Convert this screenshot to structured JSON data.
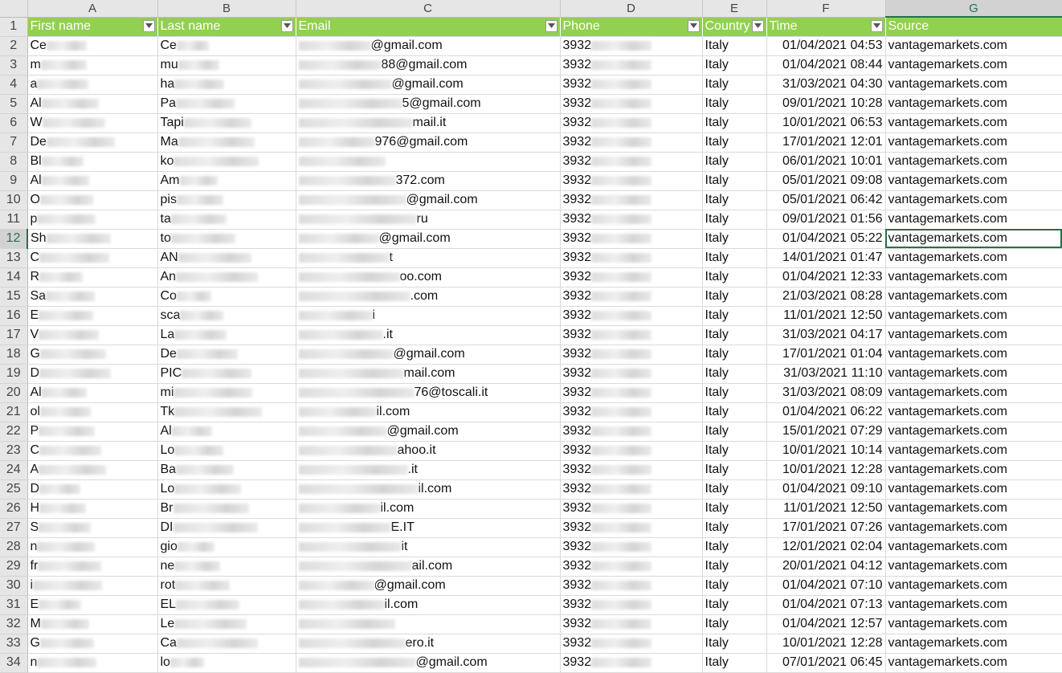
{
  "columns": [
    "A",
    "B",
    "C",
    "D",
    "E",
    "F",
    "G"
  ],
  "headers": [
    "First name",
    "Last name",
    "Email",
    "Phone",
    "Country",
    "Time",
    "Source"
  ],
  "rows": [
    {
      "num": "2",
      "first": "Ce",
      "last": "Ce",
      "email": "@gmail.com",
      "phone": "3932",
      "country": "Italy",
      "time": "01/04/2021 04:53",
      "source": "vantagemarkets.com"
    },
    {
      "num": "3",
      "first": "m",
      "last": "mu",
      "email": "88@gmail.com",
      "phone": "3932",
      "country": "Italy",
      "time": "01/04/2021 08:44",
      "source": "vantagemarkets.com"
    },
    {
      "num": "4",
      "first": "a",
      "last": "ha",
      "email": "@gmail.com",
      "phone": "3932",
      "country": "Italy",
      "time": "31/03/2021 04:30",
      "source": "vantagemarkets.com"
    },
    {
      "num": "5",
      "first": "Al",
      "last": "Pa",
      "email": "5@gmail.com",
      "phone": "3932",
      "country": "Italy",
      "time": "09/01/2021 10:28",
      "source": "vantagemarkets.com"
    },
    {
      "num": "6",
      "first": "W",
      "last": "Tapi",
      "email": "mail.it",
      "phone": "3932",
      "country": "Italy",
      "time": "10/01/2021 06:53",
      "source": "vantagemarkets.com"
    },
    {
      "num": "7",
      "first": "De",
      "last": "Ma",
      "email": "976@gmail.com",
      "phone": "3932",
      "country": "Italy",
      "time": "17/01/2021 12:01",
      "source": "vantagemarkets.com"
    },
    {
      "num": "8",
      "first": "Bl",
      "last": "ko",
      "email": "",
      "phone": "3932",
      "country": "Italy",
      "time": "06/01/2021 10:01",
      "source": "vantagemarkets.com"
    },
    {
      "num": "9",
      "first": "Al",
      "last": "Am",
      "email": "372.com",
      "phone": "3932",
      "country": "Italy",
      "time": "05/01/2021 09:08",
      "source": "vantagemarkets.com"
    },
    {
      "num": "10",
      "first": "O",
      "last": "pis",
      "email": "@gmail.com",
      "phone": "3932",
      "country": "Italy",
      "time": "05/01/2021 06:42",
      "source": "vantagemarkets.com"
    },
    {
      "num": "11",
      "first": "p",
      "last": "ta",
      "email": "ru",
      "phone": "3932",
      "country": "Italy",
      "time": "09/01/2021 01:56",
      "source": "vantagemarkets.com"
    },
    {
      "num": "12",
      "first": "Sh",
      "last": "to",
      "email": "@gmail.com",
      "phone": "3932",
      "country": "Italy",
      "time": "01/04/2021 05:22",
      "source": "vantagemarkets.com"
    },
    {
      "num": "13",
      "first": "C",
      "last": "AN",
      "email": "t",
      "phone": "3932",
      "country": "Italy",
      "time": "14/01/2021 01:47",
      "source": "vantagemarkets.com"
    },
    {
      "num": "14",
      "first": "R",
      "last": "An",
      "email": "oo.com",
      "phone": "3932",
      "country": "Italy",
      "time": "01/04/2021 12:33",
      "source": "vantagemarkets.com"
    },
    {
      "num": "15",
      "first": "Sa",
      "last": "Co",
      "email": ".com",
      "phone": "3932",
      "country": "Italy",
      "time": "21/03/2021 08:28",
      "source": "vantagemarkets.com"
    },
    {
      "num": "16",
      "first": "E",
      "last": "sca",
      "email": "i",
      "phone": "3932",
      "country": "Italy",
      "time": "11/01/2021 12:50",
      "source": "vantagemarkets.com"
    },
    {
      "num": "17",
      "first": "V",
      "last": "La",
      "email": ".it",
      "phone": "3932",
      "country": "Italy",
      "time": "31/03/2021 04:17",
      "source": "vantagemarkets.com"
    },
    {
      "num": "18",
      "first": "G",
      "last": "De",
      "email": "@gmail.com",
      "phone": "3932",
      "country": "Italy",
      "time": "17/01/2021 01:04",
      "source": "vantagemarkets.com"
    },
    {
      "num": "19",
      "first": "D",
      "last": "PIC",
      "email": "mail.com",
      "phone": "3932",
      "country": "Italy",
      "time": "31/03/2021 11:10",
      "source": "vantagemarkets.com"
    },
    {
      "num": "20",
      "first": "Al",
      "last": "mi",
      "email": "76@toscali.it",
      "phone": "3932",
      "country": "Italy",
      "time": "31/03/2021 08:09",
      "source": "vantagemarkets.com"
    },
    {
      "num": "21",
      "first": "ol",
      "last": "Tk",
      "email": "il.com",
      "phone": "3932",
      "country": "Italy",
      "time": "01/04/2021 06:22",
      "source": "vantagemarkets.com"
    },
    {
      "num": "22",
      "first": "P",
      "last": "Al",
      "email": "@gmail.com",
      "phone": "3932",
      "country": "Italy",
      "time": "15/01/2021 07:29",
      "source": "vantagemarkets.com"
    },
    {
      "num": "23",
      "first": "C",
      "last": "Lo",
      "email": "ahoo.it",
      "phone": "3932",
      "country": "Italy",
      "time": "10/01/2021 10:14",
      "source": "vantagemarkets.com"
    },
    {
      "num": "24",
      "first": "A",
      "last": "Ba",
      "email": ".it",
      "phone": "3932",
      "country": "Italy",
      "time": "10/01/2021 12:28",
      "source": "vantagemarkets.com"
    },
    {
      "num": "25",
      "first": "D",
      "last": "Lo",
      "email": "il.com",
      "phone": "3932",
      "country": "Italy",
      "time": "01/04/2021 09:10",
      "source": "vantagemarkets.com"
    },
    {
      "num": "26",
      "first": "H",
      "last": "Br",
      "email": "il.com",
      "phone": "3932",
      "country": "Italy",
      "time": "11/01/2021 12:50",
      "source": "vantagemarkets.com"
    },
    {
      "num": "27",
      "first": "S",
      "last": "DI",
      "email": "E.IT",
      "phone": "3932",
      "country": "Italy",
      "time": "17/01/2021 07:26",
      "source": "vantagemarkets.com"
    },
    {
      "num": "28",
      "first": "n",
      "last": "gio",
      "email": "it",
      "phone": "3932",
      "country": "Italy",
      "time": "12/01/2021 02:04",
      "source": "vantagemarkets.com"
    },
    {
      "num": "29",
      "first": "fr",
      "last": "ne",
      "email": "ail.com",
      "phone": "3932",
      "country": "Italy",
      "time": "20/01/2021 04:12",
      "source": "vantagemarkets.com"
    },
    {
      "num": "30",
      "first": "i",
      "last": "rot",
      "email": "@gmail.com",
      "phone": "3932",
      "country": "Italy",
      "time": "01/04/2021 07:10",
      "source": "vantagemarkets.com"
    },
    {
      "num": "31",
      "first": "E",
      "last": "EL",
      "email": "il.com",
      "phone": "3932",
      "country": "Italy",
      "time": "01/04/2021 07:13",
      "source": "vantagemarkets.com"
    },
    {
      "num": "32",
      "first": "M",
      "last": "Le",
      "email": "",
      "phone": "3932",
      "country": "Italy",
      "time": "01/04/2021 12:57",
      "source": "vantagemarkets.com"
    },
    {
      "num": "33",
      "first": "G",
      "last": "Ca",
      "email": "ero.it",
      "phone": "3932",
      "country": "Italy",
      "time": "10/01/2021 12:28",
      "source": "vantagemarkets.com"
    },
    {
      "num": "34",
      "first": "n",
      "last": "lo",
      "email": "@gmail.com",
      "phone": "3932",
      "country": "Italy",
      "time": "07/01/2021 06:45",
      "source": "vantagemarkets.com"
    }
  ],
  "header_row_num": "1",
  "colors": {
    "header_green": "#92d050",
    "selection": "#217346"
  },
  "icons": {
    "filter": "filter-dropdown-icon"
  }
}
